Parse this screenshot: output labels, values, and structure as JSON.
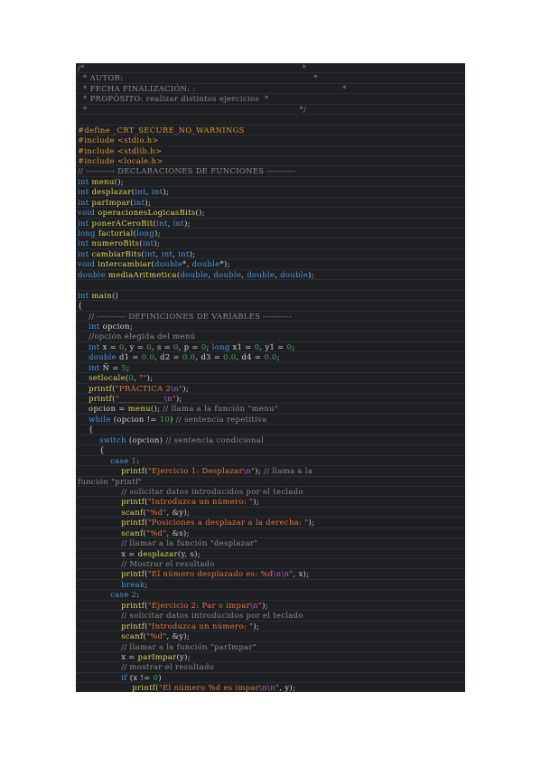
{
  "document": {
    "lines": [
      [
        [
          "cm",
          "/*                                                                                *"
        ]
      ],
      [
        [
          "cm",
          "  * AUTOR:                                                                      *"
        ]
      ],
      [
        [
          "cm",
          "  * FECHA FINALIZACIÓN: :                                                      *"
        ]
      ],
      [
        [
          "cm",
          "  * PROPÓSITO: realizar distintos ejercicios  *"
        ]
      ],
      [
        [
          "cm",
          "  *                                                                              */"
        ]
      ],
      [],
      [
        [
          "pp",
          "#define _CRT_SECURE_NO_WARNINGS"
        ]
      ],
      [
        [
          "pp",
          "#include <stdio.h>"
        ]
      ],
      [
        [
          "pp",
          "#include <stdlib.h>"
        ]
      ],
      [
        [
          "pp",
          "#include <locale.h>"
        ]
      ],
      [
        [
          "cm",
          "// ---------- DECLARACIONES DE FUNCIONES ----------"
        ]
      ],
      [
        [
          "kw",
          "int "
        ],
        [
          "fn",
          "menu"
        ],
        [
          "txt",
          "();"
        ]
      ],
      [
        [
          "kw",
          "int "
        ],
        [
          "fn",
          "desplazar"
        ],
        [
          "txt",
          "("
        ],
        [
          "kw",
          "int"
        ],
        [
          "txt",
          ", "
        ],
        [
          "kw",
          "int"
        ],
        [
          "txt",
          ");"
        ]
      ],
      [
        [
          "kw",
          "int "
        ],
        [
          "fn",
          "parImpar"
        ],
        [
          "txt",
          "("
        ],
        [
          "kw",
          "int"
        ],
        [
          "txt",
          ");"
        ]
      ],
      [
        [
          "kw",
          "void "
        ],
        [
          "fn",
          "operacionesLogicasBits"
        ],
        [
          "txt",
          "();"
        ]
      ],
      [
        [
          "kw",
          "int "
        ],
        [
          "fn",
          "ponerACeroBit"
        ],
        [
          "txt",
          "("
        ],
        [
          "kw",
          "int"
        ],
        [
          "txt",
          ", "
        ],
        [
          "kw",
          "int"
        ],
        [
          "txt",
          ");"
        ]
      ],
      [
        [
          "kw",
          "long "
        ],
        [
          "fn",
          "factorial"
        ],
        [
          "txt",
          "("
        ],
        [
          "kw",
          "long"
        ],
        [
          "txt",
          ");"
        ]
      ],
      [
        [
          "kw",
          "int "
        ],
        [
          "fn",
          "numeroBits"
        ],
        [
          "txt",
          "("
        ],
        [
          "kw",
          "int"
        ],
        [
          "txt",
          ");"
        ]
      ],
      [
        [
          "kw",
          "int "
        ],
        [
          "fn",
          "cambiarBits"
        ],
        [
          "txt",
          "("
        ],
        [
          "kw",
          "int"
        ],
        [
          "txt",
          ", "
        ],
        [
          "kw",
          "int"
        ],
        [
          "txt",
          ", "
        ],
        [
          "kw",
          "int"
        ],
        [
          "txt",
          ");"
        ]
      ],
      [
        [
          "kw",
          "void "
        ],
        [
          "fn",
          "intercambiar"
        ],
        [
          "txt",
          "("
        ],
        [
          "kw",
          "double"
        ],
        [
          "txt",
          "*, "
        ],
        [
          "kw",
          "double"
        ],
        [
          "txt",
          "*);"
        ]
      ],
      [
        [
          "kw",
          "double "
        ],
        [
          "fn",
          "mediaAritmetica"
        ],
        [
          "txt",
          "("
        ],
        [
          "kw",
          "double"
        ],
        [
          "txt",
          ", "
        ],
        [
          "kw",
          "double"
        ],
        [
          "txt",
          ", "
        ],
        [
          "kw",
          "double"
        ],
        [
          "txt",
          ", "
        ],
        [
          "kw",
          "double"
        ],
        [
          "txt",
          ");"
        ]
      ],
      [],
      [
        [
          "kw",
          "int "
        ],
        [
          "fn",
          "main"
        ],
        [
          "txt",
          "()"
        ]
      ],
      [
        [
          "txt",
          "{"
        ]
      ],
      [
        [
          "txt",
          "    "
        ],
        [
          "cm",
          "// ---------- DEFINICIONES DE VARIABLES ----------"
        ]
      ],
      [
        [
          "txt",
          "    "
        ],
        [
          "kw",
          "int "
        ],
        [
          "txt",
          "opcion;"
        ]
      ],
      [
        [
          "txt",
          "    "
        ],
        [
          "cm",
          "//opción elegida del menú"
        ]
      ],
      [
        [
          "txt",
          "    "
        ],
        [
          "kw",
          "int "
        ],
        [
          "txt",
          "x = "
        ],
        [
          "num",
          "0"
        ],
        [
          "txt",
          ", y = "
        ],
        [
          "num",
          "0"
        ],
        [
          "txt",
          ", s = "
        ],
        [
          "num",
          "0"
        ],
        [
          "txt",
          ", p = "
        ],
        [
          "num",
          "0"
        ],
        [
          "txt",
          "; "
        ],
        [
          "kw",
          "long "
        ],
        [
          "txt",
          "x1 = "
        ],
        [
          "num",
          "0"
        ],
        [
          "txt",
          ", y1 = "
        ],
        [
          "num",
          "0"
        ],
        [
          "txt",
          ";"
        ]
      ],
      [
        [
          "txt",
          "    "
        ],
        [
          "kw",
          "double "
        ],
        [
          "txt",
          "d1 = "
        ],
        [
          "num",
          "0.0"
        ],
        [
          "txt",
          ", d2 = "
        ],
        [
          "num",
          "0.0"
        ],
        [
          "txt",
          ", d3 = "
        ],
        [
          "num",
          "0.0"
        ],
        [
          "txt",
          ", d4 = "
        ],
        [
          "num",
          "0.0"
        ],
        [
          "txt",
          ";"
        ]
      ],
      [
        [
          "txt",
          "    "
        ],
        [
          "kw",
          "int "
        ],
        [
          "txt",
          "Ñ = "
        ],
        [
          "num",
          "5"
        ],
        [
          "txt",
          ";"
        ]
      ],
      [
        [
          "txt",
          "    "
        ],
        [
          "fn",
          "setlocale"
        ],
        [
          "txt",
          "("
        ],
        [
          "num",
          "0"
        ],
        [
          "txt",
          ", "
        ],
        [
          "st",
          "\"\""
        ],
        [
          "txt",
          ");"
        ]
      ],
      [
        [
          "txt",
          "    "
        ],
        [
          "fn",
          "printf"
        ],
        [
          "txt",
          "("
        ],
        [
          "st",
          "\"PRÁCTICA 2"
        ],
        [
          "esc",
          "\\n"
        ],
        [
          "st",
          "\""
        ],
        [
          "txt",
          ");"
        ]
      ],
      [
        [
          "txt",
          "    "
        ],
        [
          "fn",
          "printf"
        ],
        [
          "txt",
          "("
        ],
        [
          "st",
          "\"___________"
        ],
        [
          "esc",
          "\\n"
        ],
        [
          "st",
          "\""
        ],
        [
          "txt",
          ");"
        ]
      ],
      [
        [
          "txt",
          "    opcion = "
        ],
        [
          "fn",
          "menu"
        ],
        [
          "txt",
          "(); "
        ],
        [
          "cm",
          "// llama a la función \"menu\""
        ]
      ],
      [
        [
          "txt",
          "    "
        ],
        [
          "kw",
          "while "
        ],
        [
          "txt",
          "(opcion != "
        ],
        [
          "num",
          "10"
        ],
        [
          "txt",
          ") "
        ],
        [
          "cm",
          "// sentencia repetitiva"
        ]
      ],
      [
        [
          "txt",
          "    {"
        ]
      ],
      [
        [
          "txt",
          "        "
        ],
        [
          "kw",
          "switch "
        ],
        [
          "txt",
          "(opcion) "
        ],
        [
          "cm",
          "// sentencia condicional"
        ]
      ],
      [
        [
          "txt",
          "        {"
        ]
      ],
      [
        [
          "txt",
          "            "
        ],
        [
          "kw",
          "case "
        ],
        [
          "num",
          "1"
        ],
        [
          "txt",
          ":"
        ]
      ],
      [
        [
          "txt",
          "                "
        ],
        [
          "fn",
          "printf"
        ],
        [
          "txt",
          "("
        ],
        [
          "st",
          "\"Ejercicio 1: Desplazar"
        ],
        [
          "esc",
          "\\n"
        ],
        [
          "st",
          "\""
        ],
        [
          "txt",
          "); "
        ],
        [
          "cm",
          "// llama a la"
        ]
      ],
      [
        [
          "cm",
          "función \"printf\""
        ]
      ],
      [
        [
          "txt",
          "                "
        ],
        [
          "cm",
          "// solicitar datos introducidos por el teclado"
        ]
      ],
      [
        [
          "txt",
          "                "
        ],
        [
          "fn",
          "printf"
        ],
        [
          "txt",
          "("
        ],
        [
          "st",
          "\"Introduzca un número: \""
        ],
        [
          "txt",
          ");"
        ]
      ],
      [
        [
          "txt",
          "                "
        ],
        [
          "fn",
          "scanf"
        ],
        [
          "txt",
          "("
        ],
        [
          "st",
          "\"%d\""
        ],
        [
          "txt",
          ", &y);"
        ]
      ],
      [
        [
          "txt",
          "                "
        ],
        [
          "fn",
          "printf"
        ],
        [
          "txt",
          "("
        ],
        [
          "st",
          "\"Posiciones a desplazar a la derecha: \""
        ],
        [
          "txt",
          ");"
        ]
      ],
      [
        [
          "txt",
          "                "
        ],
        [
          "fn",
          "scanf"
        ],
        [
          "txt",
          "("
        ],
        [
          "st",
          "\"%d\""
        ],
        [
          "txt",
          ", &s);"
        ]
      ],
      [
        [
          "txt",
          "                "
        ],
        [
          "cm",
          "// llamar a la función \"desplazar\""
        ]
      ],
      [
        [
          "txt",
          "                x = "
        ],
        [
          "fn",
          "desplazar"
        ],
        [
          "txt",
          "(y, s);"
        ]
      ],
      [
        [
          "txt",
          "                "
        ],
        [
          "cm",
          "// Mostrar el resultado"
        ]
      ],
      [
        [
          "txt",
          "                "
        ],
        [
          "fn",
          "printf"
        ],
        [
          "txt",
          "("
        ],
        [
          "st",
          "\"El número desplazado es: %d"
        ],
        [
          "esc",
          "\\n\\n"
        ],
        [
          "st",
          "\""
        ],
        [
          "txt",
          ", x);"
        ]
      ],
      [
        [
          "txt",
          "                "
        ],
        [
          "kw",
          "break"
        ],
        [
          "txt",
          ";"
        ]
      ],
      [
        [
          "txt",
          "            "
        ],
        [
          "kw",
          "case "
        ],
        [
          "num",
          "2"
        ],
        [
          "txt",
          ":"
        ]
      ],
      [
        [
          "txt",
          "                "
        ],
        [
          "fn",
          "printf"
        ],
        [
          "txt",
          "("
        ],
        [
          "st",
          "\"Ejercicio 2: Par o impar"
        ],
        [
          "esc",
          "\\n"
        ],
        [
          "st",
          "\""
        ],
        [
          "txt",
          ");"
        ]
      ],
      [
        [
          "txt",
          "                "
        ],
        [
          "cm",
          "// solicitar datos introducidos por el teclado"
        ]
      ],
      [
        [
          "txt",
          "                "
        ],
        [
          "fn",
          "printf"
        ],
        [
          "txt",
          "("
        ],
        [
          "st",
          "\"Introduzca un número: \""
        ],
        [
          "txt",
          ");"
        ]
      ],
      [
        [
          "txt",
          "                "
        ],
        [
          "fn",
          "scanf"
        ],
        [
          "txt",
          "("
        ],
        [
          "st",
          "\"%d\""
        ],
        [
          "txt",
          ", &y);"
        ]
      ],
      [
        [
          "txt",
          "                "
        ],
        [
          "cm",
          "// llamar a la función \"parImpar\""
        ]
      ],
      [
        [
          "txt",
          "                x = "
        ],
        [
          "fn",
          "parImpar"
        ],
        [
          "txt",
          "(y);"
        ]
      ],
      [
        [
          "txt",
          "                "
        ],
        [
          "cm",
          "// mostrar el resultado"
        ]
      ],
      [
        [
          "txt",
          "                "
        ],
        [
          "kw",
          "if "
        ],
        [
          "txt",
          "(x != "
        ],
        [
          "num",
          "0"
        ],
        [
          "txt",
          ")"
        ]
      ],
      [
        [
          "txt",
          "                    "
        ],
        [
          "fn",
          "printf"
        ],
        [
          "txt",
          "("
        ],
        [
          "st",
          "\"El número %d es impar"
        ],
        [
          "esc",
          "\\n\\n"
        ],
        [
          "st",
          "\""
        ],
        [
          "txt",
          ", y);"
        ]
      ]
    ]
  }
}
